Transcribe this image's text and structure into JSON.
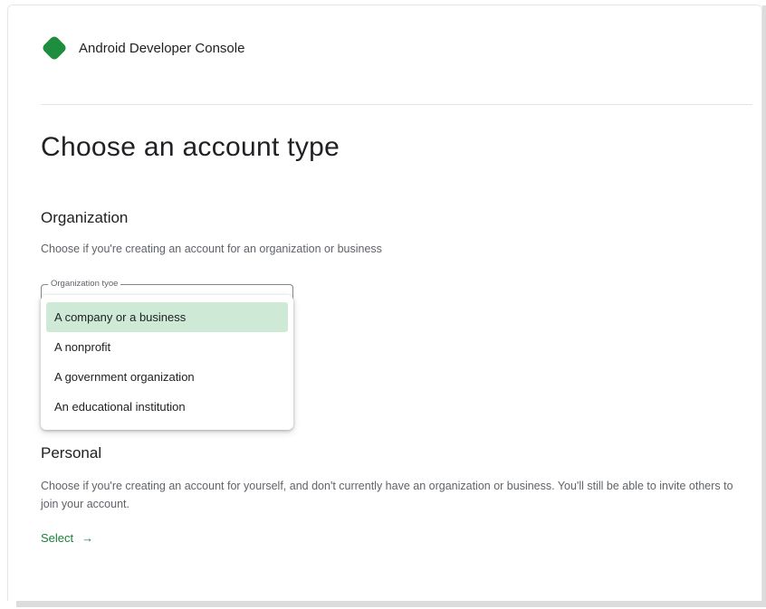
{
  "header": {
    "app_name": "Android Developer Console",
    "logo_icon": "green-diamond-logo",
    "logo_color": "#1e8e3e"
  },
  "page": {
    "title": "Choose an account type"
  },
  "organization": {
    "title": "Organization",
    "description": "Choose if you're creating an account for an organization or business",
    "field_label": "Organization tyoe",
    "options": [
      "A company or a business",
      "A nonprofit",
      "A government organization",
      "An educational institution"
    ],
    "highlighted_option": "A company or a business",
    "highlight_color": "#ceead6"
  },
  "personal": {
    "title": "Personal",
    "description": "Choose if you're creating an account for yourself, and don't currently have an organization or business. You'll still be able to invite others to join your account.",
    "select_label": "Select",
    "select_icon": "arrow-right-icon",
    "link_color": "#188038"
  }
}
